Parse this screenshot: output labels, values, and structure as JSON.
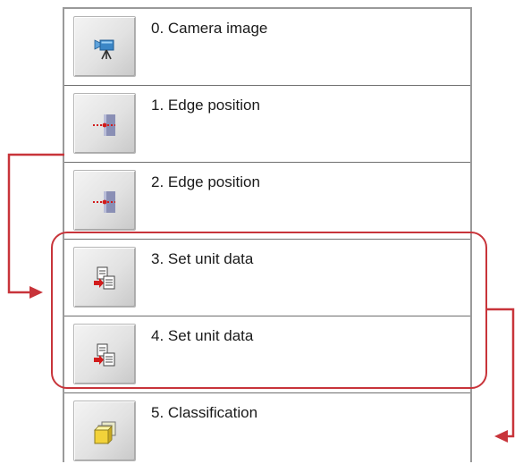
{
  "sequence": {
    "items": [
      {
        "label": "0. Camera image",
        "icon": "camera-icon"
      },
      {
        "label": "1. Edge position",
        "icon": "edge-position-icon"
      },
      {
        "label": "2. Edge position",
        "icon": "edge-position-icon"
      },
      {
        "label": "3. Set unit data",
        "icon": "set-unit-data-icon"
      },
      {
        "label": "4. Set unit data",
        "icon": "set-unit-data-icon"
      },
      {
        "label": "5. Classification",
        "icon": "classification-icon"
      }
    ]
  },
  "colors": {
    "accent_red": "#c8343a",
    "row_border": "#6f6f6f",
    "panel_border": "#9a9a9a"
  }
}
